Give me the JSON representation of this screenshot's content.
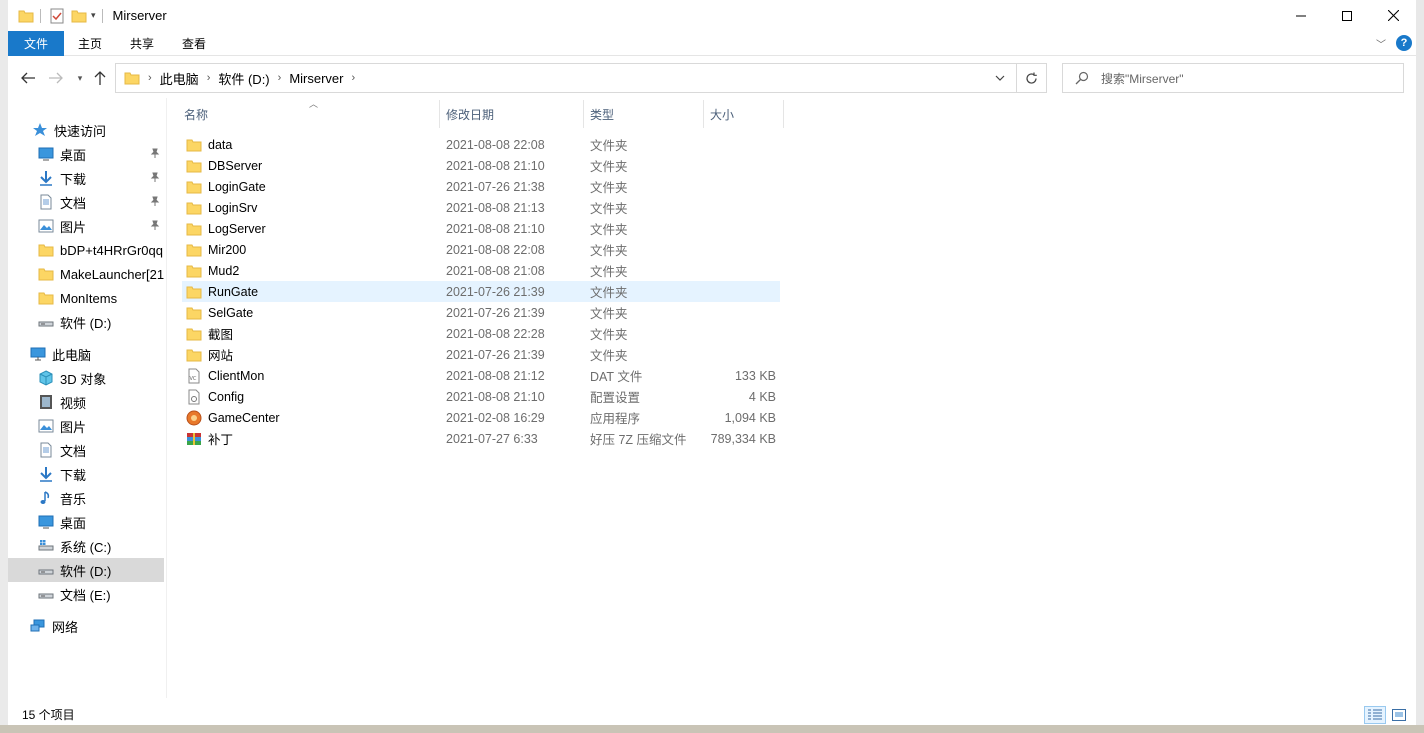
{
  "window": {
    "title": "Mirserver"
  },
  "ribbon": {
    "tabs": [
      "文件",
      "主页",
      "共享",
      "查看"
    ]
  },
  "address": {
    "crumbs": [
      "此电脑",
      "软件 (D:)",
      "Mirserver"
    ],
    "search_placeholder": "搜索\"Mirserver\""
  },
  "nav": {
    "quick_access": "快速访问",
    "quick_items": [
      {
        "label": "桌面",
        "icon": "desktop-icon",
        "pinned": true
      },
      {
        "label": "下载",
        "icon": "download-icon",
        "pinned": true
      },
      {
        "label": "文档",
        "icon": "document-icon",
        "pinned": true
      },
      {
        "label": "图片",
        "icon": "picture-icon",
        "pinned": true
      },
      {
        "label": "bDP+t4HRrGr0qq",
        "icon": "folder-icon"
      },
      {
        "label": "MakeLauncher[21",
        "icon": "folder-icon"
      },
      {
        "label": "MonItems",
        "icon": "folder-icon"
      },
      {
        "label": "软件 (D:)",
        "icon": "drive-icon"
      }
    ],
    "this_pc": "此电脑",
    "pc_items": [
      {
        "label": "3D 对象",
        "icon": "cube-icon"
      },
      {
        "label": "视频",
        "icon": "video-icon"
      },
      {
        "label": "图片",
        "icon": "picture-icon"
      },
      {
        "label": "文档",
        "icon": "document-icon"
      },
      {
        "label": "下载",
        "icon": "download-icon"
      },
      {
        "label": "音乐",
        "icon": "music-icon"
      },
      {
        "label": "桌面",
        "icon": "desktop-icon"
      },
      {
        "label": "系统 (C:)",
        "icon": "system-drive-icon"
      },
      {
        "label": "软件 (D:)",
        "icon": "drive-icon",
        "selected": true
      },
      {
        "label": "文档 (E:)",
        "icon": "drive-icon"
      }
    ],
    "network": "网络"
  },
  "columns": [
    "名称",
    "修改日期",
    "类型",
    "大小"
  ],
  "files": [
    {
      "name": "data",
      "date": "2021-08-08 22:08",
      "type": "文件夹",
      "size": "",
      "icon": "folder-icon"
    },
    {
      "name": "DBServer",
      "date": "2021-08-08 21:10",
      "type": "文件夹",
      "size": "",
      "icon": "folder-icon"
    },
    {
      "name": "LoginGate",
      "date": "2021-07-26 21:38",
      "type": "文件夹",
      "size": "",
      "icon": "folder-icon"
    },
    {
      "name": "LoginSrv",
      "date": "2021-08-08 21:13",
      "type": "文件夹",
      "size": "",
      "icon": "folder-icon"
    },
    {
      "name": "LogServer",
      "date": "2021-08-08 21:10",
      "type": "文件夹",
      "size": "",
      "icon": "folder-icon"
    },
    {
      "name": "Mir200",
      "date": "2021-08-08 22:08",
      "type": "文件夹",
      "size": "",
      "icon": "folder-icon"
    },
    {
      "name": "Mud2",
      "date": "2021-08-08 21:08",
      "type": "文件夹",
      "size": "",
      "icon": "folder-icon"
    },
    {
      "name": "RunGate",
      "date": "2021-07-26 21:39",
      "type": "文件夹",
      "size": "",
      "icon": "folder-icon",
      "hover": true
    },
    {
      "name": "SelGate",
      "date": "2021-07-26 21:39",
      "type": "文件夹",
      "size": "",
      "icon": "folder-icon"
    },
    {
      "name": "截图",
      "date": "2021-08-08 22:28",
      "type": "文件夹",
      "size": "",
      "icon": "folder-icon"
    },
    {
      "name": "网站",
      "date": "2021-07-26 21:39",
      "type": "文件夹",
      "size": "",
      "icon": "folder-icon"
    },
    {
      "name": "ClientMon",
      "date": "2021-08-08 21:12",
      "type": "DAT 文件",
      "size": "133 KB",
      "icon": "dat-file-icon"
    },
    {
      "name": "Config",
      "date": "2021-08-08 21:10",
      "type": "配置设置",
      "size": "4 KB",
      "icon": "config-file-icon"
    },
    {
      "name": "GameCenter",
      "date": "2021-02-08 16:29",
      "type": "应用程序",
      "size": "1,094 KB",
      "icon": "app-icon"
    },
    {
      "name": "补丁",
      "date": "2021-07-27 6:33",
      "type": "好压 7Z 压缩文件",
      "size": "789,334 KB",
      "icon": "archive-icon"
    }
  ],
  "status": {
    "item_count": "15 个项目"
  }
}
